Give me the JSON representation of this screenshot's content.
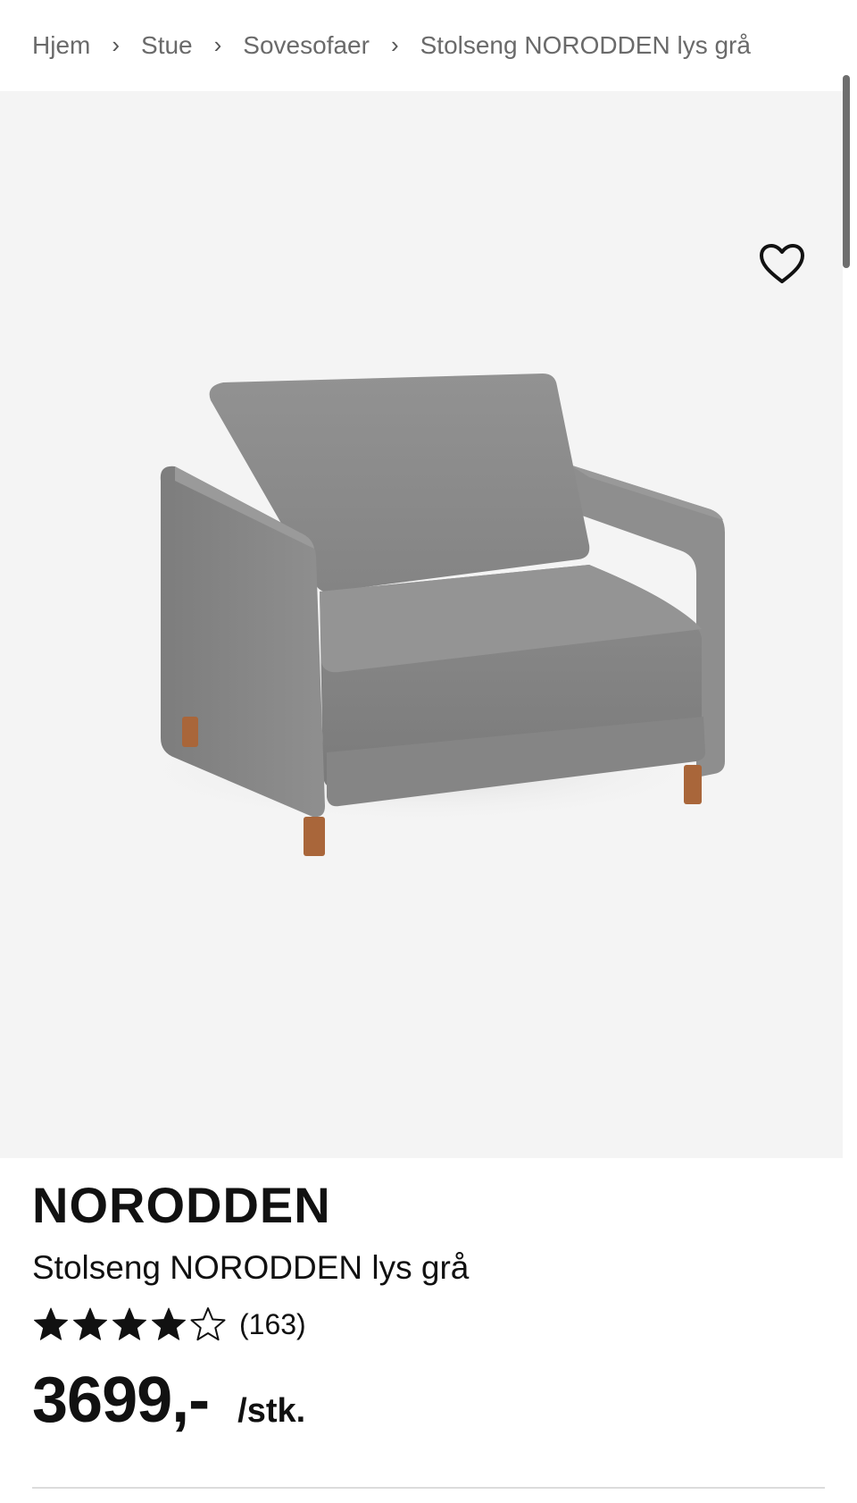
{
  "breadcrumb": {
    "items": [
      "Hjem",
      "Stue",
      "Sovesofaer",
      "Stolseng NORODDEN lys grå"
    ],
    "separator": "›"
  },
  "gallery": {
    "favorite_icon": "heart-outline-icon",
    "image_count": 4,
    "active_image": 1,
    "background": "#f4f4f4"
  },
  "product": {
    "name": "NORODDEN",
    "description": "Stolseng NORODDEN lys grå",
    "rating": 4,
    "rating_max": 5,
    "rating_count": "(163)",
    "price": "3699,-",
    "unit": "/stk."
  },
  "colors": {
    "text": "#111111",
    "muted": "#6a6a6a",
    "fabric": "#8a8a8a",
    "legs": "#a9663a"
  }
}
